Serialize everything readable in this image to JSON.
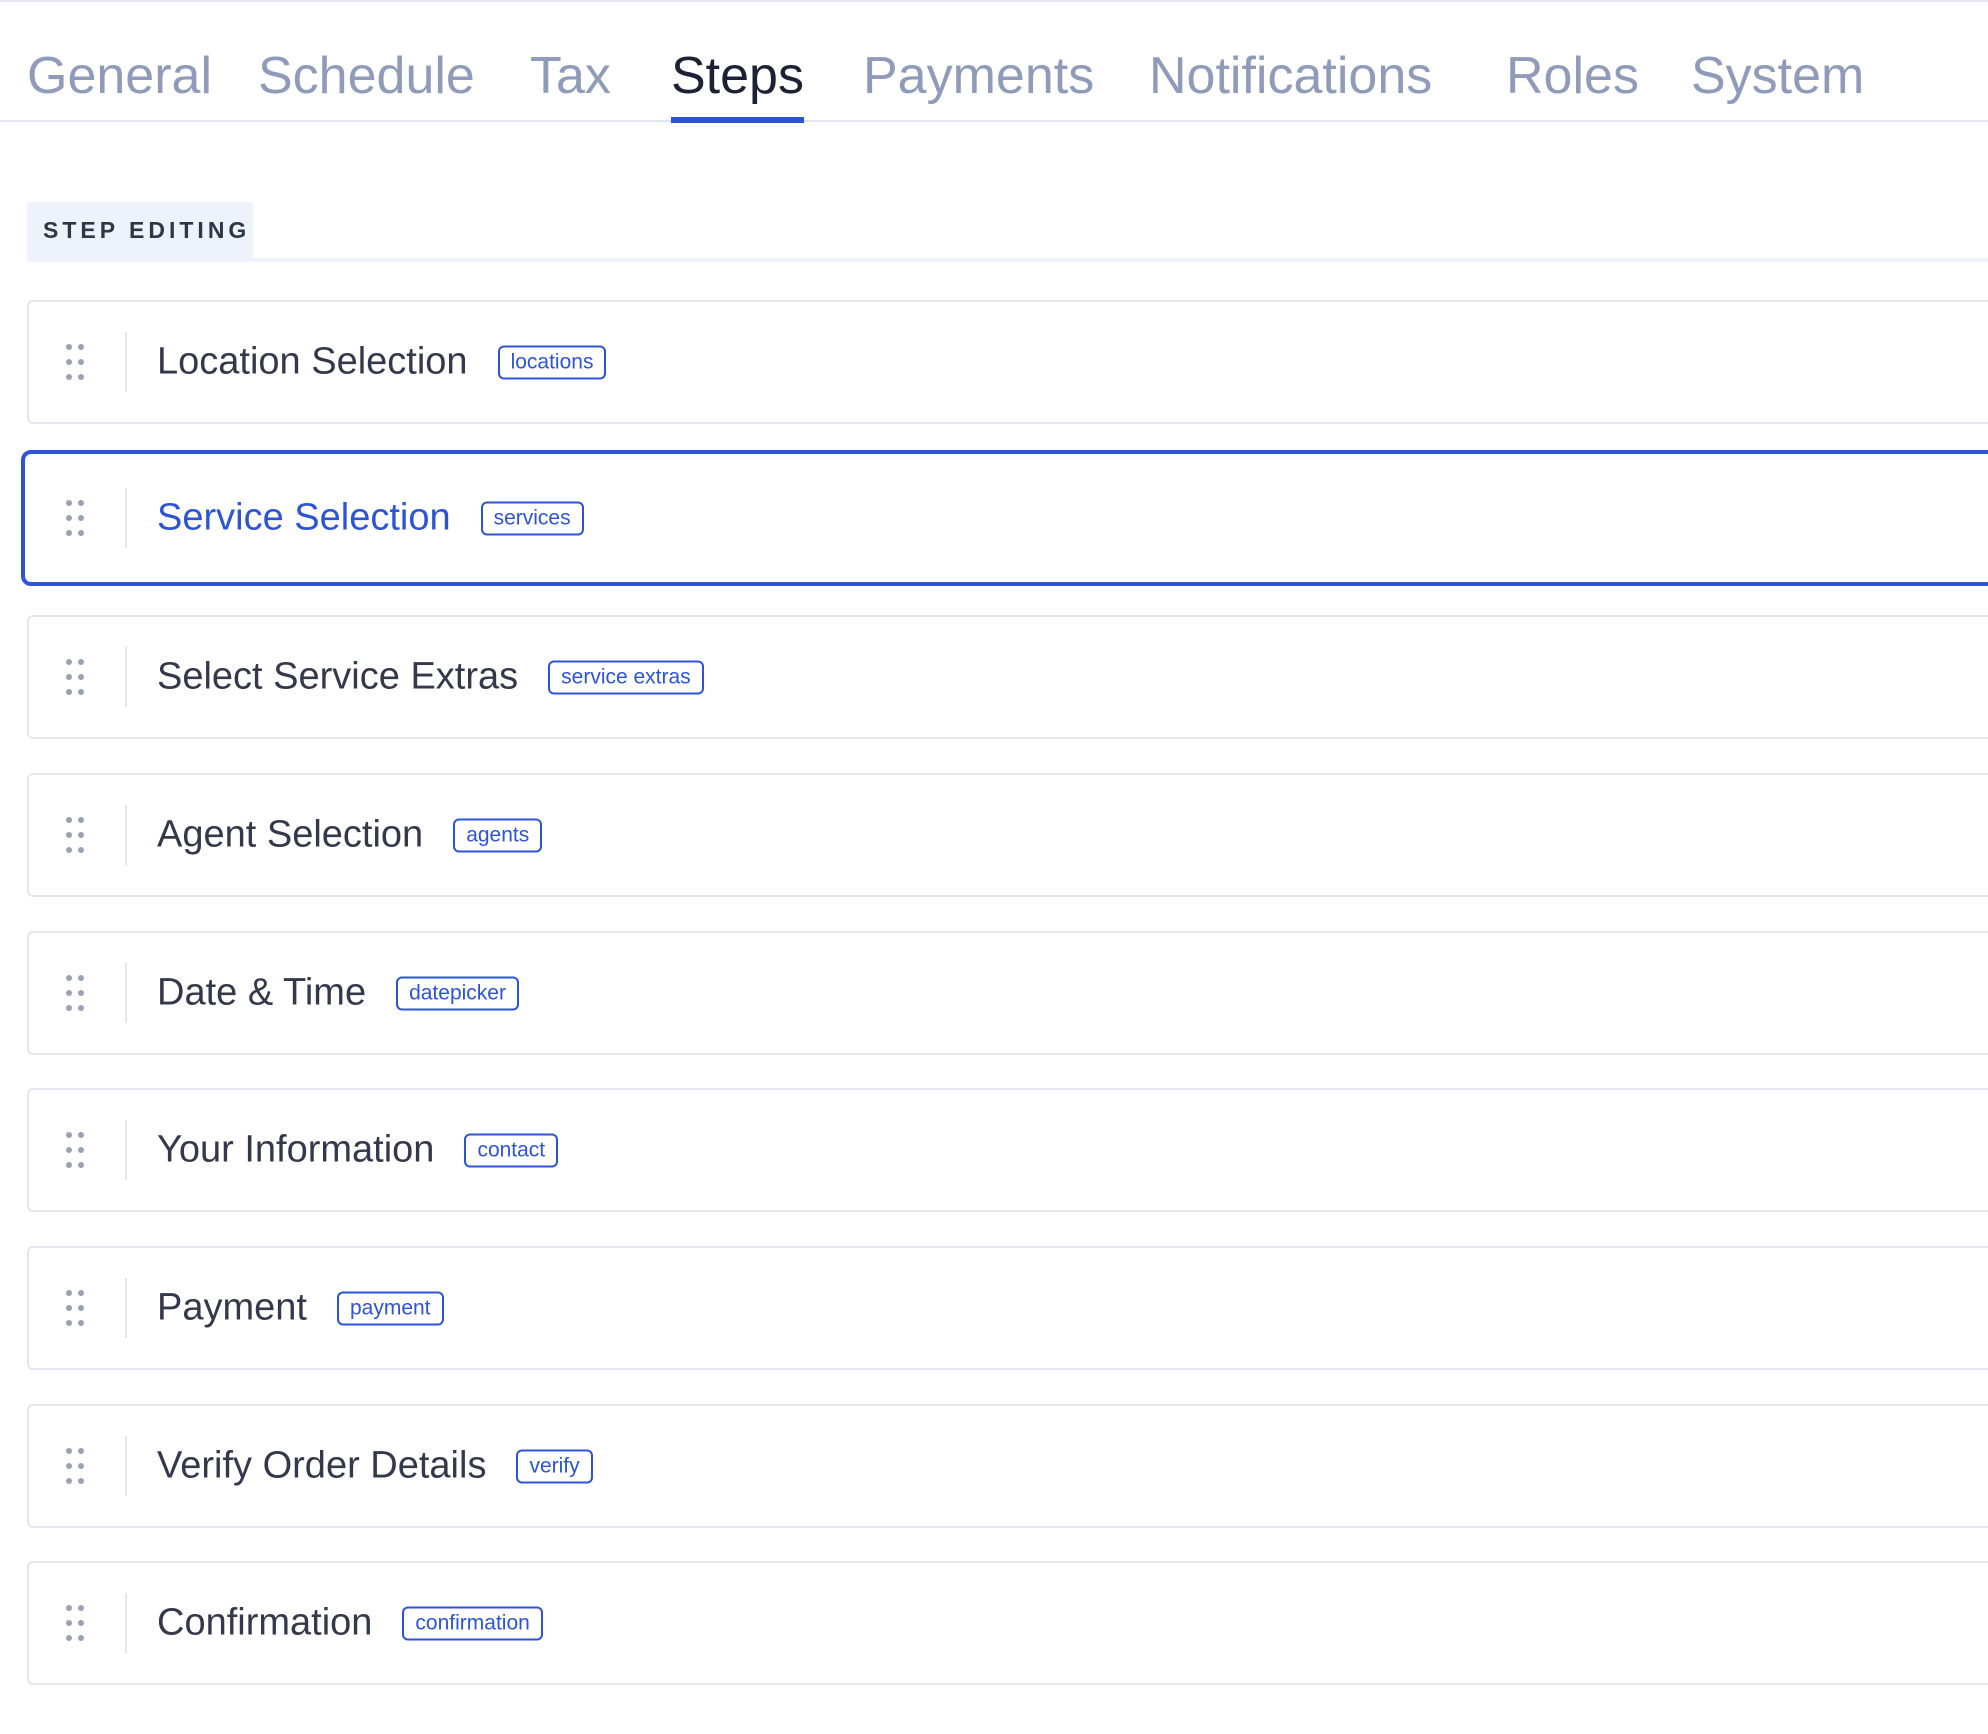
{
  "tabs": [
    {
      "label": "General",
      "active": false
    },
    {
      "label": "Schedule",
      "active": false
    },
    {
      "label": "Tax",
      "active": false
    },
    {
      "label": "Steps",
      "active": true
    },
    {
      "label": "Payments",
      "active": false
    },
    {
      "label": "Notifications",
      "active": false
    },
    {
      "label": "Roles",
      "active": false
    },
    {
      "label": "System",
      "active": false
    }
  ],
  "section": {
    "title": "STEP EDITING"
  },
  "steps": [
    {
      "title": "Location Selection",
      "code": "locations",
      "selected": false
    },
    {
      "title": "Service Selection",
      "code": "services",
      "selected": true
    },
    {
      "title": "Select Service Extras",
      "code": "service extras",
      "selected": false
    },
    {
      "title": "Agent Selection",
      "code": "agents",
      "selected": false
    },
    {
      "title": "Date & Time",
      "code": "datepicker",
      "selected": false
    },
    {
      "title": "Your Information",
      "code": "contact",
      "selected": false
    },
    {
      "title": "Payment",
      "code": "payment",
      "selected": false
    },
    {
      "title": "Verify Order Details",
      "code": "verify",
      "selected": false
    },
    {
      "title": "Confirmation",
      "code": "confirmation",
      "selected": false
    }
  ],
  "colors": {
    "accent": "#2d54d6",
    "tab_inactive": "#8f9bb8",
    "tab_active": "#1c2233",
    "text": "#33384a",
    "border": "#e3e6ee"
  }
}
